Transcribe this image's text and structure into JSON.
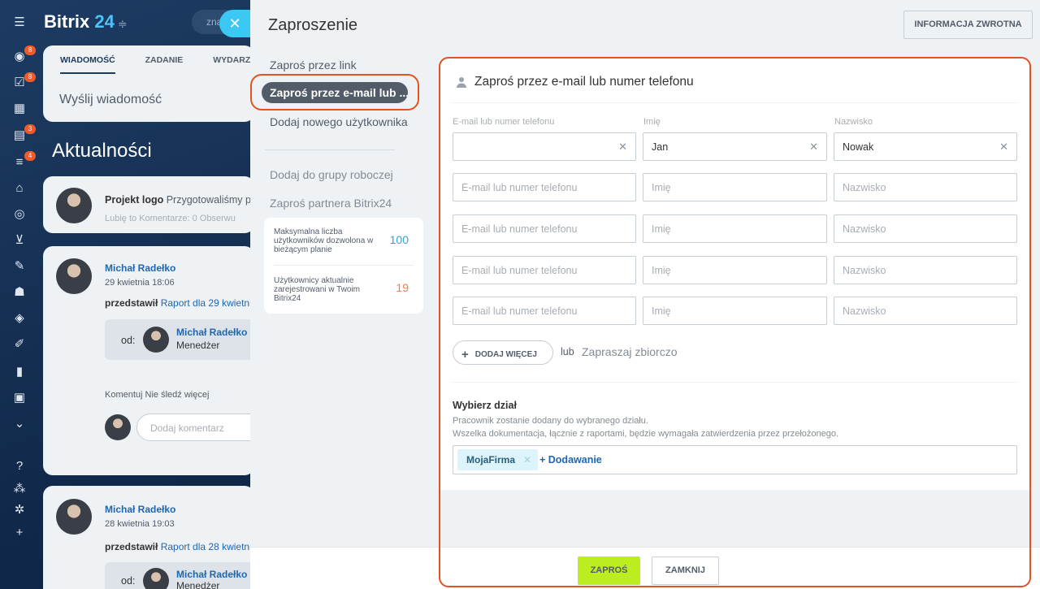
{
  "background": {
    "logo_main": "Bitrix",
    "logo_num": "24",
    "search_text": "zna",
    "tabs": [
      "WIADOMOŚĆ",
      "ZADANIE",
      "WYDARZI"
    ],
    "send_message": "Wyślij wiadomość",
    "feed_title": "Aktualności",
    "badges": [
      "8",
      "8",
      "3",
      "4"
    ],
    "post1": {
      "title": "Projekt logo",
      "text": "Przygotowaliśmy p",
      "meta": "Lubię to   Komentarze: 0   Obserwu"
    },
    "post2": {
      "author": "Michał Radełko",
      "date": "29 kwietnia 18:06",
      "presented": "przedstawił",
      "report": "Raport dla 29 kwietnia",
      "from": "od:",
      "from_name": "Michał Radełko",
      "from_role": "Menedżer",
      "actions": "Komentuj   Nie śledź   więcej",
      "comment_placeholder": "Dodaj komentarz"
    },
    "post3": {
      "author": "Michał Radełko",
      "date": "28 kwietnia 19:03",
      "presented": "przedstawił",
      "report": "Raport dla 28 kwietnia",
      "from": "od:",
      "from_name": "Michał Radełko",
      "from_role": "Menedżer"
    }
  },
  "panel": {
    "title": "Zaproszenie",
    "feedback_button": "INFORMACJA ZWROTNA",
    "menu": {
      "invite_link": "Zaproś przez link",
      "invite_email": "Zaproś przez e-mail lub ...",
      "add_user": "Dodaj nowego użytkownika",
      "add_workgroup": "Dodaj do grupy roboczej",
      "invite_partner": "Zaproś partnera Bitrix24"
    },
    "limits": {
      "max_label": "Maksymalna liczba użytkowników dozwolona w bieżącym planie",
      "max_value": "100",
      "current_label": "Użytkownicy aktualnie zarejestrowani w Twoim Bitrix24",
      "current_value": "19"
    },
    "form": {
      "title": "Zaproś przez e-mail lub numer telefonu",
      "col_email": "E-mail lub numer telefonu",
      "col_name": "Imię",
      "col_surname": "Nazwisko",
      "first_row": {
        "email": "",
        "name": "Jan",
        "surname": "Nowak"
      },
      "placeholders": {
        "email": "E-mail lub numer telefonu",
        "name": "Imię",
        "surname": "Nazwisko"
      },
      "add_more": "DODAJ WIĘCEJ",
      "or": "lub",
      "bulk_invite": "Zapraszaj zbiorczo",
      "dept_title": "Wybierz dział",
      "dept_desc1": "Pracownik zostanie dodany do wybranego działu.",
      "dept_desc2": "Wszelka dokumentacja, łącznie z raportami, będzie wymagała zatwierdzenia przez przełożonego.",
      "dept_tag": "MojaFirma",
      "add_dept": "+ Dodawanie"
    },
    "footer": {
      "invite_button": "ZAPROŚ",
      "close_button": "ZAMKNIJ"
    }
  },
  "colors": {
    "accent_highlight": "#e2531f",
    "invite_button": "#bbed21",
    "link": "#2067b0"
  }
}
